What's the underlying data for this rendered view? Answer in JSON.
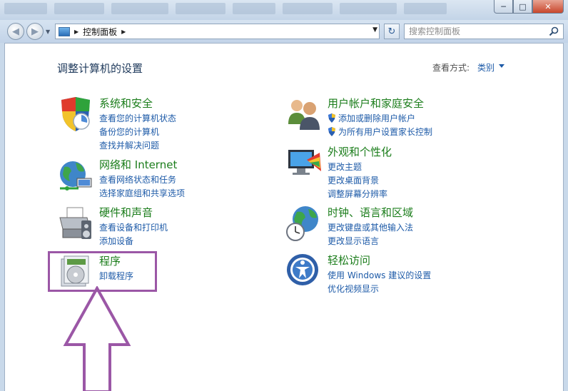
{
  "window": {
    "minimize_label": "─",
    "maximize_label": "□",
    "close_label": "✕"
  },
  "navbar": {
    "back_label": "◀",
    "forward_label": "▶",
    "breadcrumb": "控制面板",
    "search_placeholder": "搜索控制面板"
  },
  "header": {
    "title": "调整计算机的设置",
    "view_mode_label": "查看方式:",
    "view_mode_value": "类别"
  },
  "categories": [
    {
      "icon": "shield-icon",
      "title": "系统和安全",
      "links": [
        "查看您的计算机状态",
        "备份您的计算机",
        "查找并解决问题"
      ]
    },
    {
      "icon": "network-icon",
      "title": "网络和 Internet",
      "links": [
        "查看网络状态和任务",
        "选择家庭组和共享选项"
      ]
    },
    {
      "icon": "printer-icon",
      "title": "硬件和声音",
      "links": [
        "查看设备和打印机",
        "添加设备"
      ]
    },
    {
      "icon": "programs-icon",
      "title": "程序",
      "links": [
        "卸载程序"
      ]
    },
    {
      "icon": "users-icon",
      "title": "用户帐户和家庭安全",
      "links": [
        "添加或删除用户帐户",
        "为所有用户设置家长控制"
      ]
    },
    {
      "icon": "appearance-icon",
      "title": "外观和个性化",
      "links": [
        "更改主题",
        "更改桌面背景",
        "调整屏幕分辨率"
      ]
    },
    {
      "icon": "globe-clock-icon",
      "title": "时钟、语言和区域",
      "links": [
        "更改键盘或其他输入法",
        "更改显示语言"
      ]
    },
    {
      "icon": "ease-of-access-icon",
      "title": "轻松访问",
      "links": [
        "使用 Windows 建议的设置",
        "优化视频显示"
      ]
    }
  ],
  "colors": {
    "title_green": "#1b7d1b",
    "link_blue": "#1e5ba8",
    "annotation_purple": "#9b57a6"
  }
}
